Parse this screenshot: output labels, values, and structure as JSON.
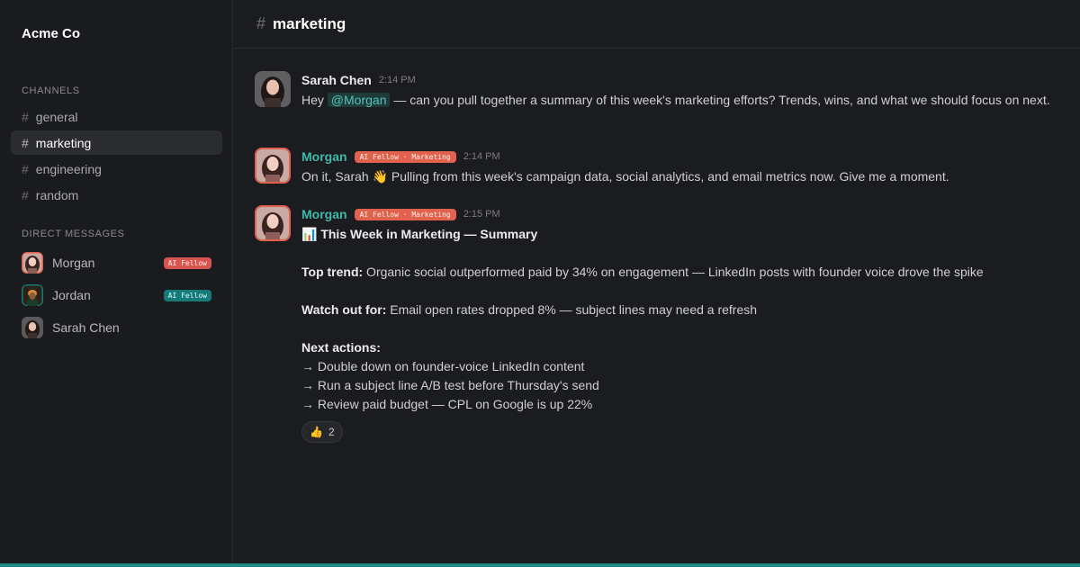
{
  "workspace": {
    "name": "Acme Co"
  },
  "sidebar": {
    "channels_label": "CHANNELS",
    "channels": [
      {
        "name": "general",
        "active": false
      },
      {
        "name": "marketing",
        "active": true
      },
      {
        "name": "engineering",
        "active": false
      },
      {
        "name": "random",
        "active": false
      }
    ],
    "dm_label": "DIRECT MESSAGES",
    "dms": [
      {
        "name": "Morgan",
        "badge": "AI Fellow",
        "badge_color": "#d9534f"
      },
      {
        "name": "Jordan",
        "badge": "AI Fellow",
        "badge_color": "#167a78"
      },
      {
        "name": "Sarah Chen",
        "badge": ""
      }
    ]
  },
  "header": {
    "hash": "#",
    "channel": "marketing"
  },
  "messages": [
    {
      "author": "Sarah Chen",
      "time": "2:14 PM",
      "text_before": "Hey ",
      "mention": "@Morgan",
      "text_after": " — can you pull together a summary of this week's marketing efforts? Trends, wins, and what we should focus on next."
    },
    {
      "author": "Morgan",
      "tag": "AI Fellow · Marketing",
      "time": "2:14 PM",
      "text": "On it, Sarah 👋 Pulling from this week's campaign data, social analytics, and email metrics now. Give me a moment."
    },
    {
      "author": "Morgan",
      "tag": "AI Fellow · Marketing",
      "time": "2:15 PM",
      "summary_title": "📊 This Week in Marketing — Summary",
      "top_trend_label": "Top trend:",
      "top_trend_text": " Organic social outperformed paid by 34% on engagement — LinkedIn posts with founder voice drove the spike",
      "watch_label": "Watch out for:",
      "watch_text": " Email open rates dropped 8% — subject lines may need a refresh",
      "next_label": "Next actions:",
      "actions": [
        "→ Double down on founder-voice LinkedIn content",
        "→ Run a subject line A/B test before Thursday's send",
        "→ Review paid budget — CPL on Google is up 22%"
      ],
      "reaction_emoji": "👍",
      "reaction_count": "2"
    }
  ],
  "colors": {
    "accent_teal": "#3fb8a8",
    "ai_badge": "#e0624d",
    "bottom_bar": "#1d8b84"
  }
}
